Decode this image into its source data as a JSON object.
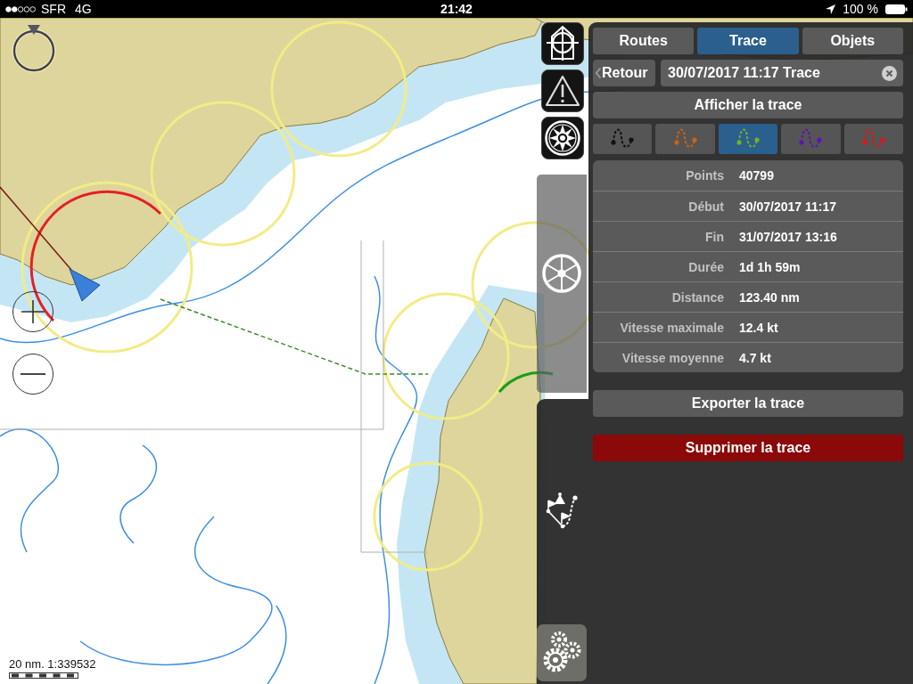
{
  "status_bar": {
    "carrier": "SFR",
    "network": "4G",
    "time": "21:42",
    "battery": "100 %"
  },
  "map": {
    "scale_label": "20 nm. 1:339532"
  },
  "panel": {
    "tabs": [
      {
        "label": "Routes",
        "selected": false
      },
      {
        "label": "Trace",
        "selected": true
      },
      {
        "label": "Objets",
        "selected": false
      }
    ],
    "back_button": "Retour",
    "track_name": {
      "value": "30/07/2017 11:17 Trace"
    },
    "show_track_button": "Afficher la trace",
    "track_colors": [
      {
        "color": "#111111",
        "selected": false
      },
      {
        "color": "#c86414",
        "selected": false
      },
      {
        "color": "#72b21e",
        "selected": true
      },
      {
        "color": "#5c14b4",
        "selected": false
      },
      {
        "color": "#e81414",
        "selected": false
      }
    ],
    "stats": [
      {
        "label": "Points",
        "value": "40799"
      },
      {
        "label": "Début",
        "value": "30/07/2017 11:17"
      },
      {
        "label": "Fin",
        "value": "31/07/2017 13:16"
      },
      {
        "label": "Durée",
        "value": "1d 1h 59m"
      },
      {
        "label": "Distance",
        "value": "123.40 nm"
      },
      {
        "label": "Vitesse maximale",
        "value": "12.4 kt"
      },
      {
        "label": "Vitesse moyenne",
        "value": "4.7 kt"
      }
    ],
    "export_button": "Exporter la trace",
    "delete_button": "Supprimer la trace"
  }
}
